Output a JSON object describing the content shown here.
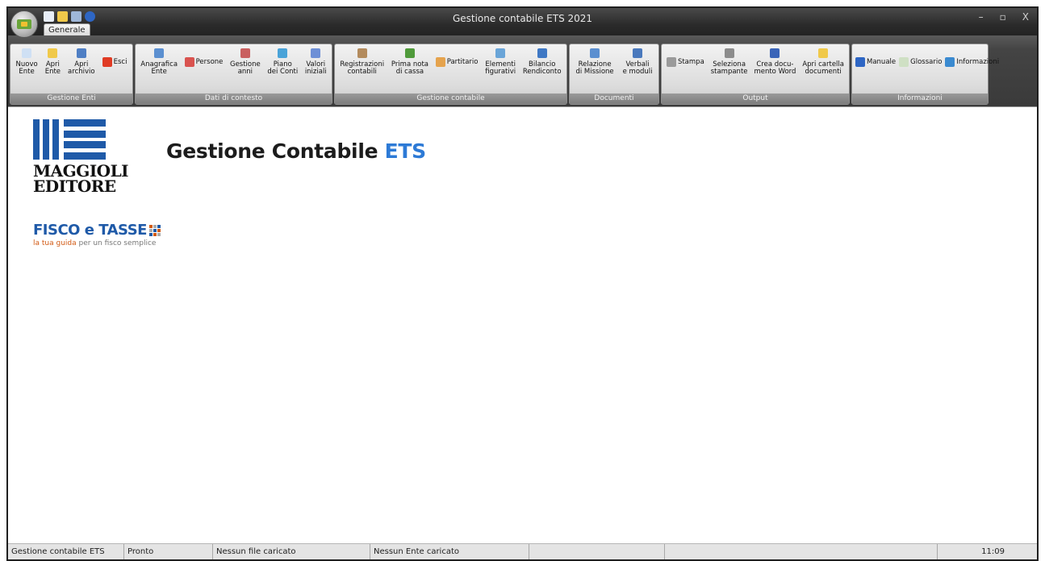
{
  "window": {
    "title": "Gestione contabile ETS 2021",
    "controls": [
      "–",
      "▫",
      "X"
    ]
  },
  "tabs": [
    {
      "label": "Generale"
    }
  ],
  "ribbon": {
    "groups": [
      {
        "label": "Gestione Enti",
        "buttons": [
          {
            "label": "Nuovo\nEnte",
            "icon": "new-doc-icon",
            "color": "#cfe0f4"
          },
          {
            "label": "Apri\nEnte",
            "icon": "open-folder-icon",
            "color": "#f0c94a"
          },
          {
            "label": "Apri\narchivio",
            "icon": "archive-icon",
            "color": "#4f7fc4"
          },
          {
            "label": "Esci",
            "icon": "exit-icon",
            "color": "#e03b24"
          }
        ]
      },
      {
        "label": "Dati di contesto",
        "buttons": [
          {
            "label": "Anagrafica\nEnte",
            "icon": "registry-icon",
            "color": "#5b8fd0"
          },
          {
            "label": "Persone",
            "icon": "people-icon",
            "color": "#d9534f"
          },
          {
            "label": "Gestione\nanni",
            "icon": "calendar-icon",
            "color": "#c95f5f"
          },
          {
            "label": "Piano\ndei Conti",
            "icon": "chart-of-accounts-icon",
            "color": "#4aa3d8"
          },
          {
            "label": "Valori\niniziali",
            "icon": "initial-values-icon",
            "color": "#6d8fd6"
          }
        ]
      },
      {
        "label": "Gestione contabile",
        "buttons": [
          {
            "label": "Registrazioni\ncontabili",
            "icon": "registrations-icon",
            "color": "#b38b5d"
          },
          {
            "label": "Prima nota\ndi cassa",
            "icon": "cash-book-icon",
            "color": "#4f9a3a"
          },
          {
            "label": "Partitario",
            "icon": "ledger-icon",
            "color": "#e5a34d"
          },
          {
            "label": "Elementi\nfigurativi",
            "icon": "figurative-elements-icon",
            "color": "#6aa5d8"
          },
          {
            "label": "Bilancio\nRendiconto",
            "icon": "balance-icon",
            "color": "#3f78c4"
          }
        ]
      },
      {
        "label": "Documenti",
        "buttons": [
          {
            "label": "Relazione\ndi Missione",
            "icon": "mission-report-icon",
            "color": "#5b8fd0"
          },
          {
            "label": "Verbali\ne moduli",
            "icon": "minutes-icon",
            "color": "#4a79bd"
          }
        ]
      },
      {
        "label": "Output",
        "buttons": [
          {
            "label": "Stampa",
            "icon": "print-icon",
            "color": "#9a9a9a"
          },
          {
            "label": "Seleziona\nstampante",
            "icon": "select-printer-icon",
            "color": "#8c8c8c"
          },
          {
            "label": "Crea docu-\nmento Word",
            "icon": "word-document-icon",
            "color": "#3a64b8"
          },
          {
            "label": "Apri cartella\ndocumenti",
            "icon": "documents-folder-icon",
            "color": "#f0c94a"
          }
        ]
      },
      {
        "label": "Informazioni",
        "buttons": [
          {
            "label": "Manuale",
            "icon": "manual-icon",
            "color": "#2e66c4"
          },
          {
            "label": "Glossario",
            "icon": "glossary-icon",
            "color": "#cfe0c4"
          },
          {
            "label": "Informazioni",
            "icon": "info-icon",
            "color": "#3a8ad0"
          }
        ]
      }
    ]
  },
  "content": {
    "logo_line1": "MAGGIOLI",
    "logo_line2": "EDITORE",
    "fisco_title_a": "FISCO e",
    "fisco_title_b": "TASSE",
    "fisco_sub_acc": "la tua guida",
    "fisco_sub_rest": " per un fisco semplice",
    "title_a": "Gestione Contabile ",
    "title_b": "ETS"
  },
  "statusbar": {
    "app": "Gestione contabile ETS",
    "state": "Pronto",
    "file": "Nessun file caricato",
    "ente": "Nessun Ente caricato",
    "time": "11:09"
  }
}
